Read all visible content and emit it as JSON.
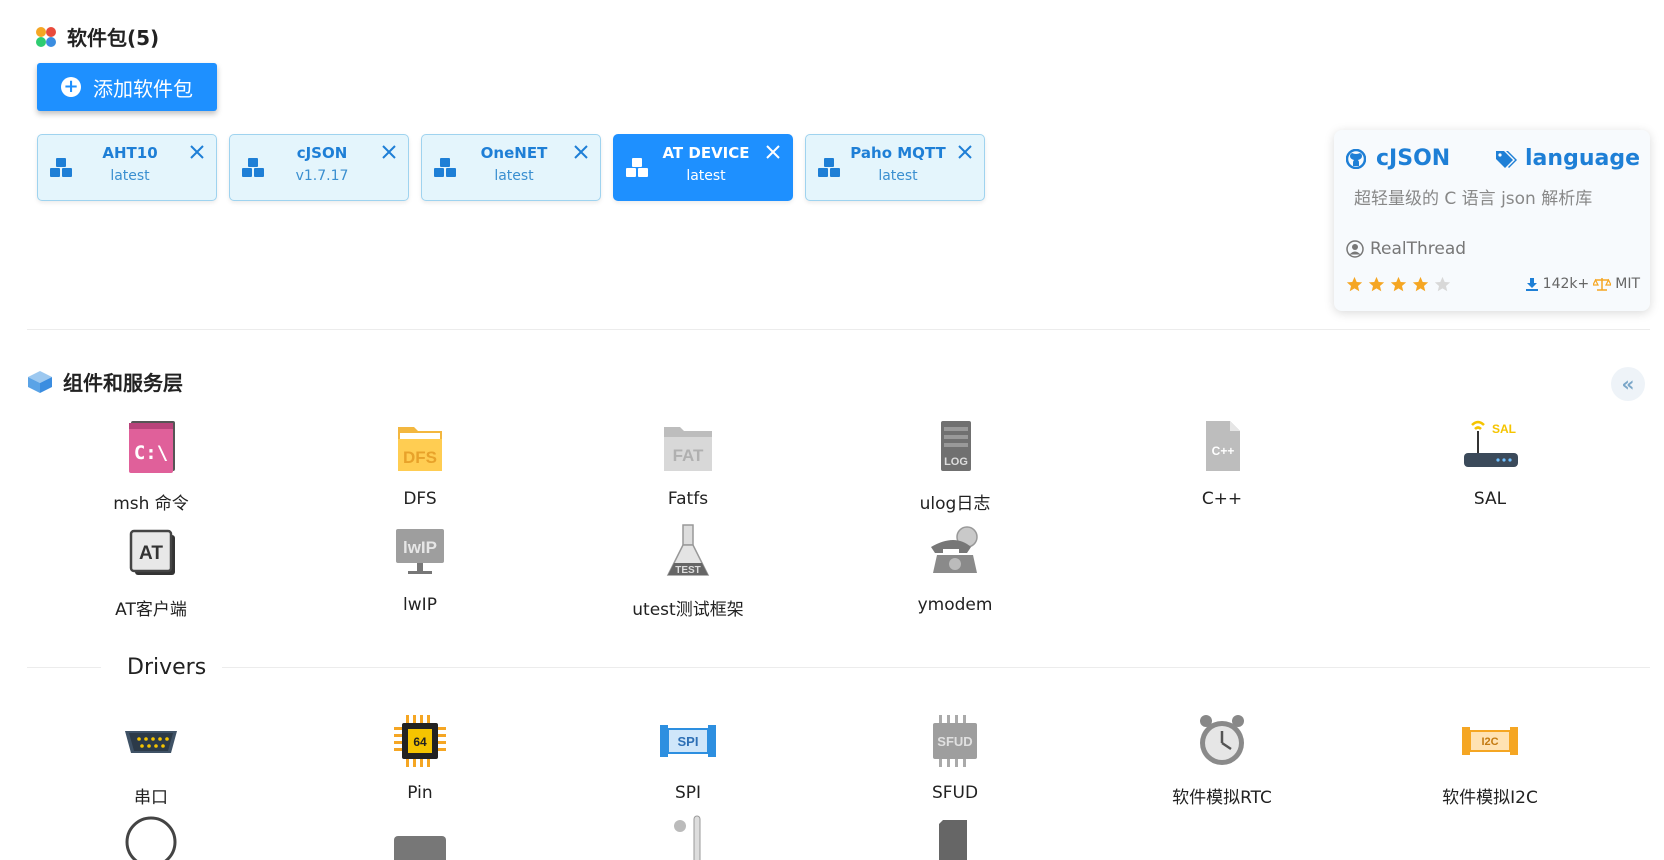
{
  "packages_section": {
    "title": "软件包(5)",
    "add_button": "添加软件包"
  },
  "packages": [
    {
      "name": "AHT10",
      "version": "latest",
      "active": false
    },
    {
      "name": "cJSON",
      "version": "v1.7.17",
      "active": false
    },
    {
      "name": "OneNET",
      "version": "latest",
      "active": false
    },
    {
      "name": "AT DEVICE",
      "version": "latest",
      "active": true
    },
    {
      "name": "Paho MQTT",
      "version": "latest",
      "active": false
    }
  ],
  "detail": {
    "name": "cJSON",
    "tag": "language",
    "description": "超轻量级的 C 语言 json 解析库",
    "author": "RealThread",
    "rating": 4,
    "downloads": "142k+",
    "license": "MIT"
  },
  "components_section": {
    "title": "组件和服务层",
    "items": [
      {
        "label": "msh 命令",
        "icon": "msh-cmd-icon"
      },
      {
        "label": "DFS",
        "icon": "dfs-folder-icon"
      },
      {
        "label": "Fatfs",
        "icon": "fat-folder-icon"
      },
      {
        "label": "ulog日志",
        "icon": "log-file-icon"
      },
      {
        "label": "C++",
        "icon": "cpp-file-icon"
      },
      {
        "label": "SAL",
        "icon": "router-icon"
      },
      {
        "label": "AT客户端",
        "icon": "at-client-icon"
      },
      {
        "label": "lwIP",
        "icon": "lwip-monitor-icon"
      },
      {
        "label": "utest测试框架",
        "icon": "test-flask-icon"
      },
      {
        "label": "ymodem",
        "icon": "telephone-icon"
      }
    ]
  },
  "drivers_section": {
    "title": "Drivers",
    "items": [
      {
        "label": "串口",
        "icon": "serial-port-icon"
      },
      {
        "label": "Pin",
        "icon": "chip-icon"
      },
      {
        "label": "SPI",
        "icon": "spi-icon"
      },
      {
        "label": "SFUD",
        "icon": "sfud-chip-icon"
      },
      {
        "label": "软件模拟RTC",
        "icon": "alarm-clock-icon"
      },
      {
        "label": "软件模拟I2C",
        "icon": "i2c-icon"
      }
    ]
  },
  "colors": {
    "accent": "#1e90ff",
    "star": "#f5a623"
  }
}
